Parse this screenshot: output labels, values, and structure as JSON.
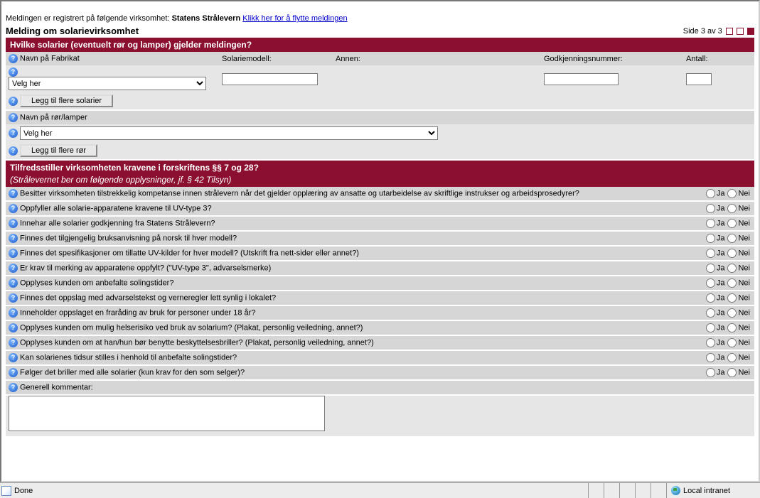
{
  "top": {
    "registered_prefix": "Meldingen er registrert på følgende virksomhet: ",
    "registered_org": "Statens Strålevern",
    "move_link": "Klikk her for å flytte meldingen"
  },
  "heading": "Melding om solarievirksomhet",
  "page_indicator": "Side 3 av 3",
  "section1": {
    "title": "Hvilke solarier (eventuelt rør og lamper) gjelder meldingen?",
    "labels": {
      "fabrikat": "Navn på Fabrikat",
      "solariemodell": "Solariemodell:",
      "annen": "Annen:",
      "godkjenning": "Godkjenningsnummer:",
      "antall": "Antall:"
    },
    "velg_her": "Velg her",
    "btn_add_solarier": "Legg til flere solarier",
    "ror_label": "Navn på rør/lamper",
    "btn_add_ror": "Legg til flere rør"
  },
  "section2": {
    "title": "Tilfredsstiller virksomheten kravene i forskriftens §§ 7 og 28?",
    "subtitle": "(Strålevernet ber om følgende opplysninger, jf. § 42 Tilsyn)",
    "ja": "Ja",
    "nei": "Nei",
    "questions": [
      "Besitter virksomheten tilstrekkelig kompetanse innen strålevern når det gjelder opplæring av ansatte og utarbeidelse av skriftlige instrukser og arbeidsprosedyrer?",
      "Oppfyller alle solarie-apparatene kravene til UV-type 3?",
      "Innehar alle solarier godkjenning fra Statens Strålevern?",
      "Finnes det tilgjengelig bruksanvisning på norsk til hver modell?",
      "Finnes det spesifikasjoner om tillatte UV-kilder for hver modell? (Utskrift fra nett-sider eller annet?)",
      "Er krav til merking av apparatene oppfylt? (\"UV-type 3\", advarselsmerke)",
      "Opplyses kunden om anbefalte solingstider?",
      "Finnes det oppslag med advarselstekst og verneregler lett synlig i lokalet?",
      "Inneholder oppslaget en fraråding av bruk for personer under 18 år?",
      "Opplyses kunden om mulig helserisiko ved bruk av solarium? (Plakat, personlig veiledning, annet?)",
      "Opplyses kunden om at han/hun bør benytte beskyttelsesbriller? (Plakat, personlig veiledning, annet?)",
      "Kan solarienes tidsur stilles i henhold til anbefalte solingstider?",
      "Følger det briller med alle solarier (kun krav for den som selger)?"
    ],
    "comment_label": "Generell kommentar:"
  },
  "status": {
    "done": "Done",
    "zone": "Local intranet"
  }
}
